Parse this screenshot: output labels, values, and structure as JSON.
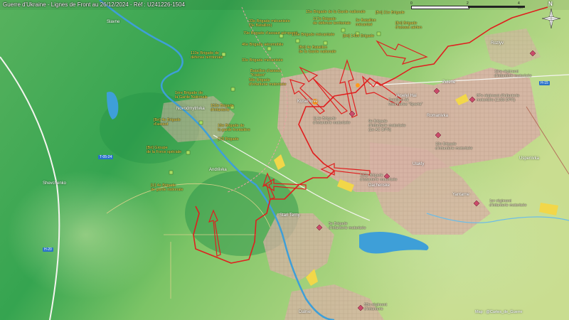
{
  "header": {
    "title": "Guerre d'Ukraine - Lignes de Front au 26/12/2024 - Réf : U241226-1504"
  },
  "scale": {
    "labels": [
      "0",
      "2",
      "4 km"
    ]
  },
  "compass": {
    "label": "N"
  },
  "credit": {
    "text": "Map : @Cartes_de_Guerre"
  },
  "colors": {
    "terrain_low": "#2fa24b",
    "terrain_high": "#a7d67a",
    "urban": "#d9b5a8",
    "water": "#4aa7d9",
    "front_line": "#e01e1e",
    "attack_arrow": "#e01e1e",
    "ua_unit": "#a8dd63",
    "ru_unit": "#c94a6a",
    "ua_label": "#ffe34d"
  },
  "towns": [
    {
      "id": "kurakhove",
      "name": "Kurakhove"
    },
    {
      "id": "zelene",
      "name": "Zelene"
    },
    {
      "id": "dachenske",
      "name": "Dachenske"
    },
    {
      "id": "yantarne",
      "name": "Yantarne"
    },
    {
      "id": "stari-terny",
      "name": "Stari Terny"
    },
    {
      "id": "novodmytrivka",
      "name": "Novodmytrivka"
    },
    {
      "id": "andriivka",
      "name": "Andriivka"
    },
    {
      "id": "ulakly",
      "name": "Ulakly"
    },
    {
      "id": "rozlyv",
      "name": "Rozlyv"
    },
    {
      "id": "shevchenko",
      "name": "Shevchenko"
    },
    {
      "id": "slavne",
      "name": "Slavne"
    },
    {
      "id": "dalnie",
      "name": "Dalnie"
    },
    {
      "id": "romanivka",
      "name": "Romanivka"
    },
    {
      "id": "uspenivka",
      "name": "Uspenivka"
    },
    {
      "id": "veselyi-hai",
      "name": "Veselyi Hai"
    }
  ],
  "roads": [
    {
      "id": "h15",
      "label": "H-15"
    },
    {
      "id": "h20",
      "label": "H-20"
    },
    {
      "id": "t0524",
      "label": "T-05-24"
    }
  ],
  "ua_units": [
    {
      "id": "ua-1",
      "text": "33e Brigade mécanisée\n(3e Bataillon)"
    },
    {
      "id": "ua-2",
      "text": "79e Brigade d'assaut aéroporté"
    },
    {
      "id": "ua-3",
      "text": "46e Brigade aéromobile"
    },
    {
      "id": "ua-4",
      "text": "33e Brigade mécanisée"
    },
    {
      "id": "ua-5",
      "text": "Bataillon d'assaut\n\"Kraken\""
    },
    {
      "id": "ua-6",
      "text": "15e Brigade de la Garde nationale"
    },
    {
      "id": "ua-7",
      "text": "117e Brigade\nde défense territoriale"
    },
    {
      "id": "ua-8",
      "text": "116e Brigade mécanisée"
    },
    {
      "id": "ua-9",
      "text": "119e Brigade de\ndéfense territoriale"
    },
    {
      "id": "ua-10",
      "text": "58e Brigade\nd'infanterie motorisée"
    },
    {
      "id": "ua-11",
      "text": "1ère Brigade de\nla Garde Nationale"
    },
    {
      "id": "ua-12",
      "text": "152e Brigade\nd'infanterie"
    },
    {
      "id": "ua-13",
      "text": "[Bri] 4e Brigade\nd'assaut"
    },
    {
      "id": "ua-14",
      "text": "16e Brigade de\nla garde frontalière"
    },
    {
      "id": "ua-15",
      "text": "[Bri] Groupe\nde la Force spéciale"
    },
    {
      "id": "ua-16",
      "text": "[U] 4e Brigade\nde garde nationale"
    },
    {
      "id": "ua-17",
      "text": "[33] Brigade"
    },
    {
      "id": "ua-18",
      "text": "[Bri] 21e Brigade"
    },
    {
      "id": "ua-19",
      "text": "3e Bataillon\nmécanisé"
    },
    {
      "id": "ua-20",
      "text": "[Bri] Brigade\nd'assaut aérien"
    },
    {
      "id": "ua-21",
      "text": "[Bri] 143e Brigade"
    },
    {
      "id": "ua-22",
      "text": "[Bri] 4e Bataillon\nde la Garde nationale"
    }
  ],
  "ru_units": [
    {
      "id": "ru-1",
      "text": "1ère régiment\nd'infanterie motorisée"
    },
    {
      "id": "ru-2",
      "text": "87e régiment d'infanterie\nmotorisée (1158 DPR)"
    },
    {
      "id": "ru-3",
      "text": "9e Brigade\nd'infanterie motorisée\n(1e AC DPR)"
    },
    {
      "id": "ru-4",
      "text": "10e Brigade\nd'infanterie motorisée"
    },
    {
      "id": "ru-5",
      "text": "114e Brigade\nd'infanterie motorisée"
    },
    {
      "id": "ru-6",
      "text": "Bataillon de\nvolontaires \"Sparta\""
    },
    {
      "id": "ru-7",
      "text": "132e Brigade\nd'infanterie motorisée"
    },
    {
      "id": "ru-8",
      "text": "5e Brigade\nd'infanterie motorisée"
    },
    {
      "id": "ru-9",
      "text": "1er régiment\nd'infanterie motorisée"
    },
    {
      "id": "ru-10",
      "text": "55e régiment\nd'infanterie"
    }
  ]
}
